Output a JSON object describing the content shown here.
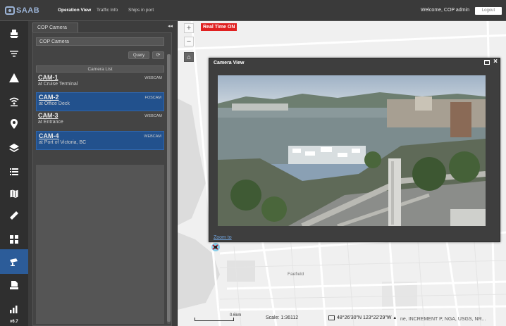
{
  "header": {
    "logo_text": "SAAB",
    "tabs": [
      "Operation View",
      "Traffic Info",
      "Ships in port"
    ],
    "welcome": "Welcome, COP admin",
    "logout": "Logout"
  },
  "sidebar": {
    "items": [
      {
        "icon": "ship-icon"
      },
      {
        "icon": "filter-icon"
      },
      {
        "icon": "warning-icon"
      },
      {
        "icon": "signal-icon"
      },
      {
        "icon": "location-pin-icon"
      },
      {
        "icon": "layers-icon"
      },
      {
        "icon": "list-icon"
      },
      {
        "icon": "map-icon"
      },
      {
        "icon": "ruler-icon"
      },
      {
        "icon": "grid-icon"
      },
      {
        "icon": "camera-icon",
        "active": true
      },
      {
        "icon": "export-icon"
      },
      {
        "icon": "chart-icon"
      }
    ],
    "version": "v6.7"
  },
  "panel": {
    "tab": "COP Camera",
    "collapse": "◂◂",
    "header": "COP Camera",
    "query_label": "Query",
    "list_header": "Camera List",
    "cameras": [
      {
        "name": "CAM-1",
        "type": "WEBCAM",
        "location": "at Cruise Terminal",
        "selected": false
      },
      {
        "name": "CAM-2",
        "type": "FOSCAM",
        "location": "at Office Deck",
        "selected": true
      },
      {
        "name": "CAM-3",
        "type": "WEBCAM",
        "location": "at Entrance",
        "selected": false
      },
      {
        "name": "CAM-4",
        "type": "WEBCAM",
        "location": "at Port of Victoria, BC",
        "selected": true
      }
    ]
  },
  "map": {
    "zoom_in": "+",
    "zoom_out": "−",
    "home": "⌂",
    "realtime_badge": "Real Time ON",
    "place_label": "Faefield",
    "scale_distance": "0.6km",
    "scale_text": "Scale: 1:36112",
    "coordinates": "48°26'30\"N  123°22'29\"W",
    "attribution": "ne, INCREMENT P, NGA, USGS, NR..."
  },
  "camera_view": {
    "title": "Camera View",
    "zoom_link": "Zoom to"
  },
  "colors": {
    "accent": "#2c5c99",
    "realtime": "#e02020",
    "selected_row": "#22518d"
  }
}
